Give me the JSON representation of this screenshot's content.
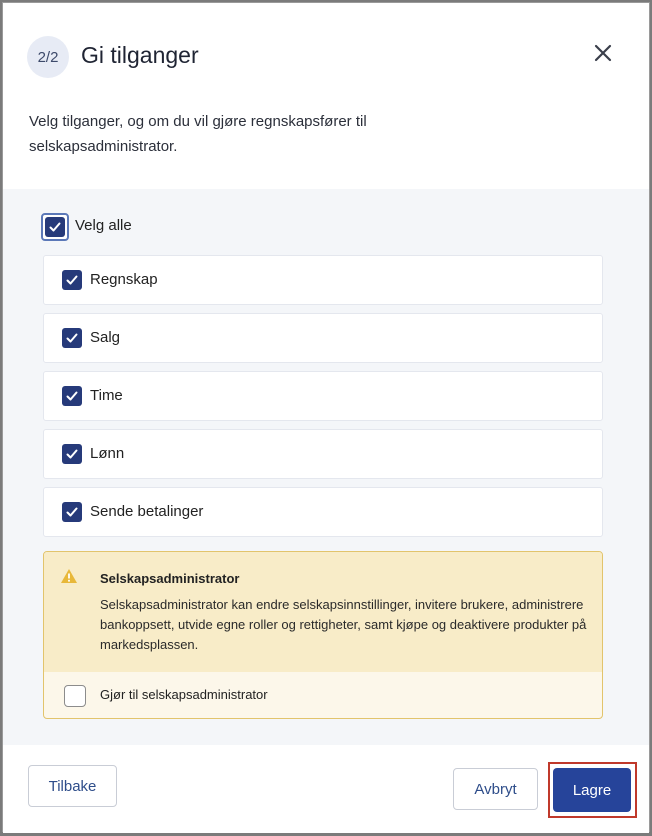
{
  "dialog": {
    "step": "2/2",
    "title": "Gi tilganger",
    "description": "Velg tilganger, og om du vil gjøre regnskapsfører til selskapsadministrator."
  },
  "permissions": {
    "select_all_label": "Velg alle",
    "select_all_checked": true,
    "items": [
      {
        "label": "Regnskap",
        "checked": true
      },
      {
        "label": "Salg",
        "checked": true
      },
      {
        "label": "Time",
        "checked": true
      },
      {
        "label": "Lønn",
        "checked": true
      },
      {
        "label": "Sende betalinger",
        "checked": true
      }
    ]
  },
  "admin_warning": {
    "title": "Selskapsadministrator",
    "text": "Selskapsadministrator kan endre selskapsinnstillinger, invitere brukere, administrere bankoppsett, utvide egne roller og rettigheter, samt kjøpe og deaktivere produkter på markedsplassen.",
    "checkbox_label": "Gjør til selskapsadministrator",
    "checked": false
  },
  "footer": {
    "back_label": "Tilbake",
    "cancel_label": "Avbryt",
    "save_label": "Lagre"
  },
  "colors": {
    "accent": "#26449a",
    "checkbox": "#263a7a",
    "warning_bg": "#f8ecc8",
    "warning_border": "#e2c46c",
    "highlight": "#c0392b"
  }
}
